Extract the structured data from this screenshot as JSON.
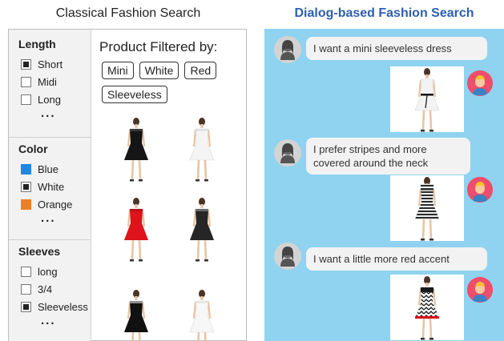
{
  "titles": {
    "classical": "Classical Fashion Search",
    "dialog": "Dialog-based Fashion Search"
  },
  "filters": {
    "length": {
      "heading": "Length",
      "options": [
        {
          "label": "Short",
          "checked": true
        },
        {
          "label": "Midi",
          "checked": false
        },
        {
          "label": "Long",
          "checked": false
        }
      ],
      "more": "..."
    },
    "color": {
      "heading": "Color",
      "options": [
        {
          "label": "Blue",
          "swatch": "#1e88e5"
        },
        {
          "label": "White",
          "checked": true
        },
        {
          "label": "Orange",
          "swatch": "#ef7d22"
        }
      ],
      "more": "..."
    },
    "sleeves": {
      "heading": "Sleeves",
      "options": [
        {
          "label": "long",
          "checked": false
        },
        {
          "label": "3/4",
          "checked": false
        },
        {
          "label": "Sleeveless",
          "checked": true
        }
      ],
      "more": "..."
    }
  },
  "products": {
    "heading": "Product Filtered by:",
    "tags": [
      "Mini",
      "White",
      "Red",
      "Sleeveless"
    ],
    "items": [
      {
        "dress_color": "#151515",
        "accent": "#555555"
      },
      {
        "dress_color": "#f4f4f4",
        "accent": "#d9d9d9"
      },
      {
        "dress_color": "#e0121b",
        "accent": "#a50d14"
      },
      {
        "dress_color": "#262626",
        "accent": "#9a9a9a"
      },
      {
        "dress_color": "#111111",
        "accent": "#e6e6e6"
      },
      {
        "dress_color": "#f7f7f7",
        "accent": "#dcdcdc"
      }
    ]
  },
  "dialog": {
    "turns": [
      {
        "user_text": "I want a mini sleeveless dress",
        "dress_color": "#f3f3f3",
        "dress_accent": "#111111",
        "pattern": "belt"
      },
      {
        "user_text": "I prefer stripes and more covered around the neck",
        "dress_color": "#cfcfcf",
        "dress_accent": "#333333",
        "pattern": "stripes"
      },
      {
        "user_text": "I want a little more red accent",
        "dress_color": "#ffffff",
        "dress_accent": "#111111",
        "pattern": "chevron-red"
      }
    ]
  },
  "colors": {
    "dialog_bg": "#8fd3f0",
    "dialog_title": "#2f5fae",
    "agent_avatar": "#ee4d6b"
  }
}
